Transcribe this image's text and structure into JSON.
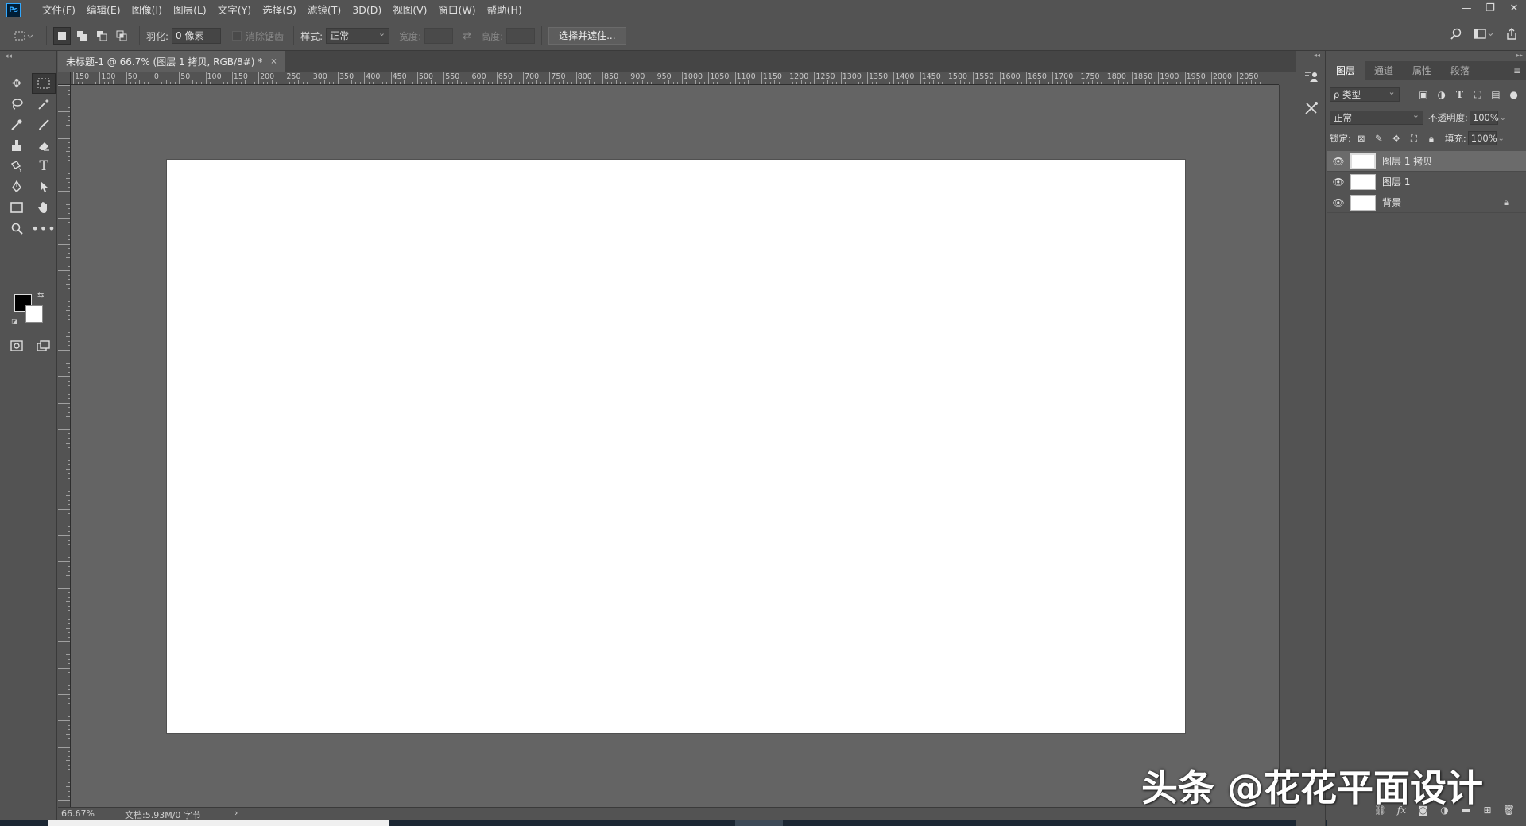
{
  "app": {
    "logo": "Ps",
    "menu": [
      "文件(F)",
      "编辑(E)",
      "图像(I)",
      "图层(L)",
      "文字(Y)",
      "选择(S)",
      "滤镜(T)",
      "3D(D)",
      "视图(V)",
      "窗口(W)",
      "帮助(H)"
    ],
    "window_controls": [
      "—",
      "❐",
      "✕"
    ]
  },
  "options": {
    "feather_label": "羽化:",
    "feather_value": "0 像素",
    "antialias_label": "消除锯齿",
    "style_label": "样式:",
    "style_value": "正常",
    "width_label": "宽度:",
    "height_label": "高度:",
    "select_mask_button": "选择并遮住..."
  },
  "document": {
    "tab_title": "未标题-1 @ 66.7% (图层 1 拷贝, RGB/8#) *",
    "close": "×",
    "zoom": "66.67%",
    "doc_info": "文档:5.93M/0 字节",
    "status_arrow": "›"
  },
  "ruler_h_labels": [
    "150",
    "100",
    "50",
    "0",
    "50",
    "100",
    "150",
    "200",
    "250",
    "300",
    "350",
    "400",
    "450",
    "500",
    "550",
    "600",
    "650",
    "700",
    "750",
    "800",
    "850",
    "900",
    "950",
    "1000",
    "1050",
    "1100",
    "1150",
    "1200",
    "1250",
    "1300",
    "1350",
    "1400",
    "1450",
    "1500",
    "1550",
    "1600",
    "1650",
    "1700",
    "1750",
    "1800",
    "1850",
    "1900",
    "1950",
    "2000",
    "2050"
  ],
  "layers_panel": {
    "tabs": [
      "图层",
      "通道",
      "属性",
      "段落"
    ],
    "filter_kind": "ρ 类型",
    "blend_mode": "正常",
    "opacity_label": "不透明度:",
    "opacity_value": "100%",
    "lock_label": "锁定:",
    "fill_label": "填充:",
    "fill_value": "100%",
    "layers": [
      {
        "name": "图层 1 拷贝",
        "selected": true,
        "locked": false
      },
      {
        "name": "图层 1",
        "selected": false,
        "locked": false
      },
      {
        "name": "背景",
        "selected": false,
        "locked": true
      }
    ]
  },
  "colors": {
    "foreground": "#000000",
    "background": "#ffffff",
    "accent": "#31a8ff"
  },
  "watermark": "头条 @花花平面设计"
}
